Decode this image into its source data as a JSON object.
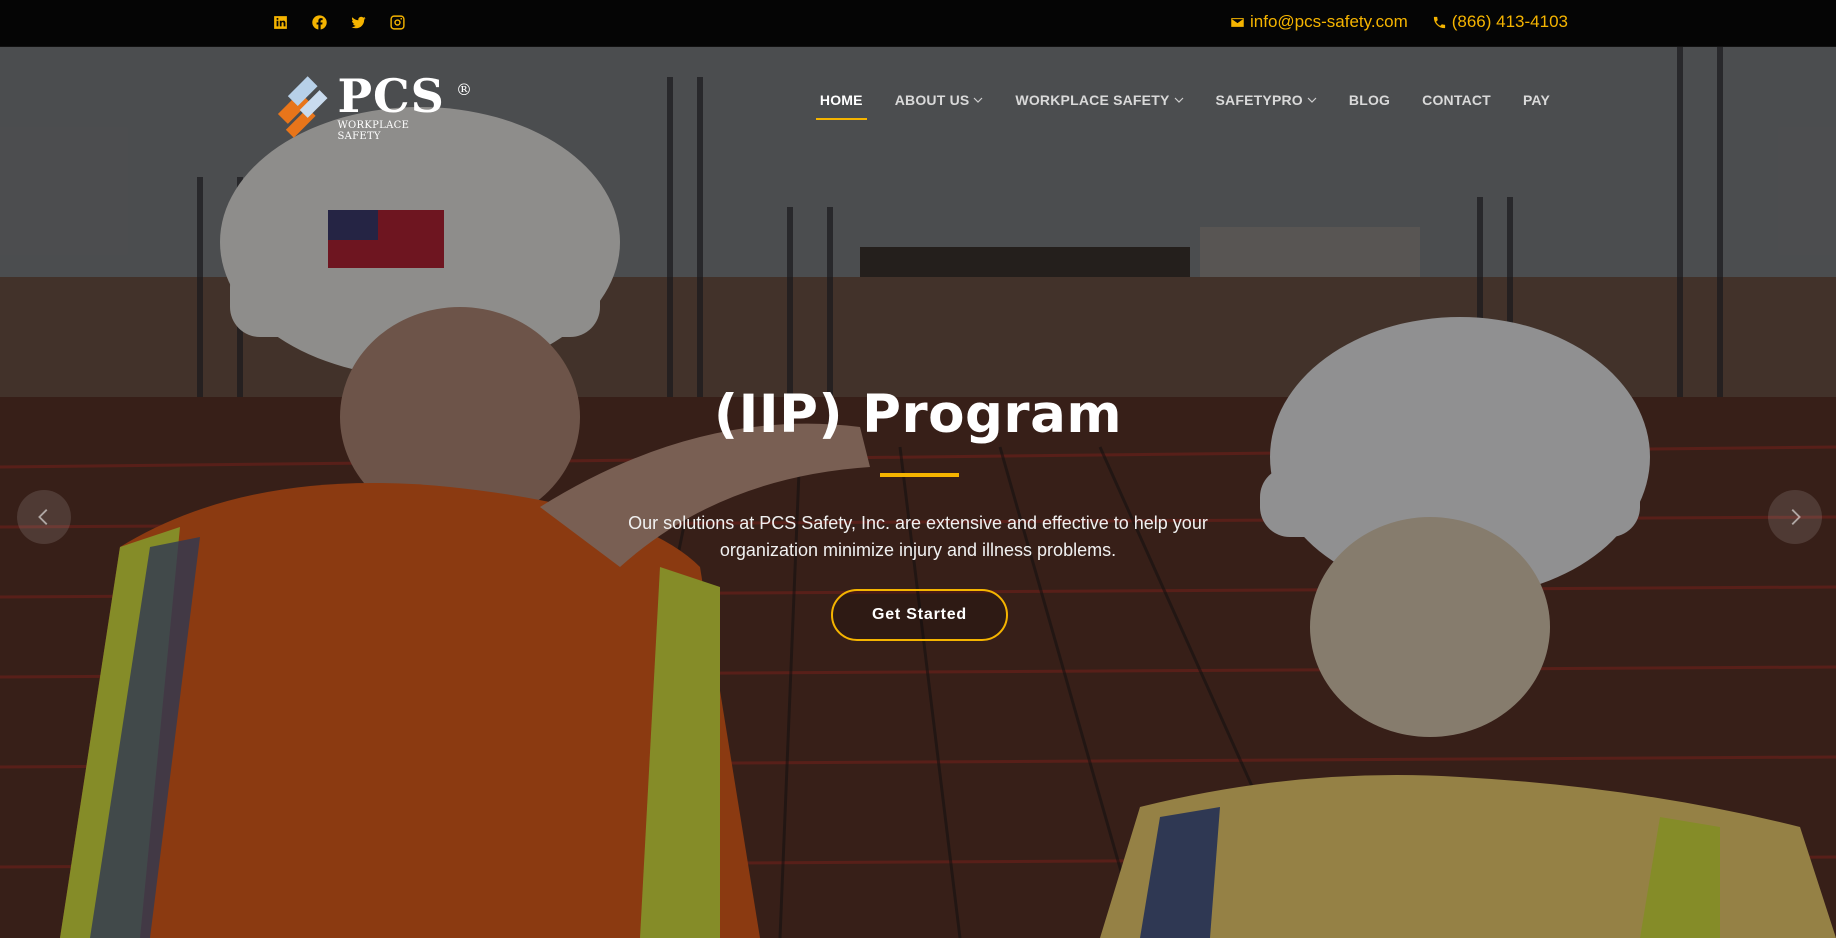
{
  "topbar": {
    "social_icons": [
      "linkedin-icon",
      "facebook-icon",
      "twitter-icon",
      "instagram-icon"
    ],
    "email": "info@pcs-safety.com",
    "phone": "(866) 413-4103"
  },
  "logo": {
    "name": "PCS",
    "registered": "®",
    "tagline": "WORKPLACE SAFETY"
  },
  "nav": {
    "items": [
      {
        "label": "HOME",
        "active": true,
        "dropdown": false
      },
      {
        "label": "ABOUT US",
        "active": false,
        "dropdown": true
      },
      {
        "label": "WORKPLACE SAFETY",
        "active": false,
        "dropdown": true
      },
      {
        "label": "SAFETYPRO",
        "active": false,
        "dropdown": true
      },
      {
        "label": "BLOG",
        "active": false,
        "dropdown": false
      },
      {
        "label": "CONTACT",
        "active": false,
        "dropdown": false
      },
      {
        "label": "PAY",
        "active": false,
        "dropdown": false
      }
    ]
  },
  "hero": {
    "title": "(IIP) Program",
    "text_line1": "Our solutions at PCS Safety, Inc. are extensive and effective to help your",
    "text_line2": "organization minimize injury and illness problems.",
    "cta_label": "Get Started"
  },
  "colors": {
    "accent": "#f5b400",
    "topbar_bg": "#050505",
    "text": "#ffffff"
  }
}
